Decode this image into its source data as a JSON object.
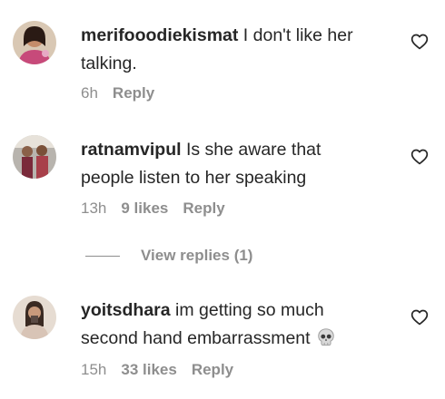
{
  "comments": [
    {
      "username": "merifooodiekismat",
      "text_line1": " I don't like her",
      "text_line2": "talking.",
      "time": "6h",
      "likes": "",
      "reply": "Reply"
    },
    {
      "username": "ratnamvipul",
      "text_line1": " Is she aware that",
      "text_line2": "people listen to her speaking",
      "time": "13h",
      "likes": "9 likes",
      "reply": "Reply"
    },
    {
      "username": "yoitsdhara",
      "text_line1": " im getting so much",
      "text_line2": "second hand embarrassment",
      "emoji": "skull",
      "time": "15h",
      "likes": "33 likes",
      "reply": "Reply"
    }
  ],
  "view_replies": "View replies (1)",
  "icons": {
    "like": "heart-outline-icon",
    "skull": "skull-emoji"
  },
  "colors": {
    "text": "#262626",
    "secondary": "#8e8e8e"
  }
}
